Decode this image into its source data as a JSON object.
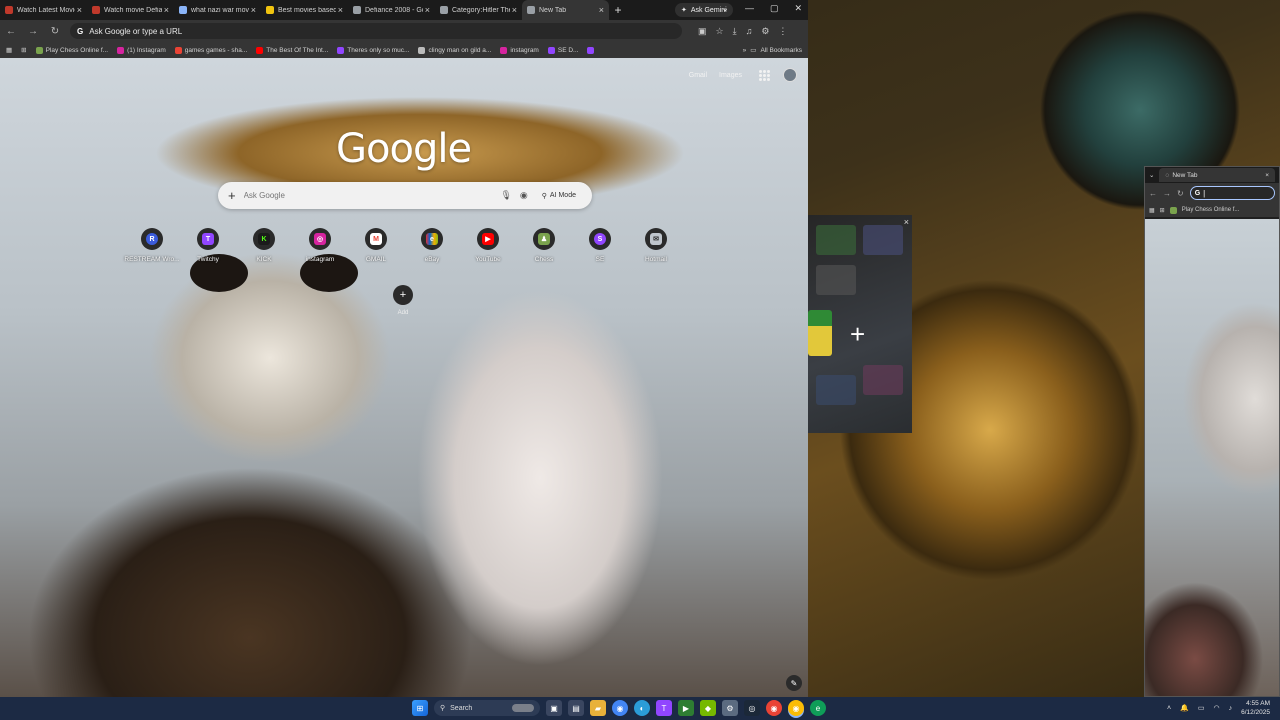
{
  "browser": {
    "tabs": [
      {
        "title": "Watch Latest Movies",
        "color": "#c0392b"
      },
      {
        "title": "Watch movie Defiance",
        "color": "#c0392b"
      },
      {
        "title": "what nazi war movie",
        "color": "#8ab4f8"
      },
      {
        "title": "Best movies based",
        "color": "#f1c40f"
      },
      {
        "title": "Defiance 2008 - Go",
        "color": "#9aa0a6"
      },
      {
        "title": "Category:Hitler The",
        "color": "#9aa0a6"
      },
      {
        "title": "New Tab",
        "color": "#9aa0a6"
      }
    ],
    "new_tab_symbol": "+",
    "gemini_label": "Ask Gemini",
    "omnibox_placeholder": "Ask Google or type a URL",
    "bookmarks": [
      {
        "label": "Play Chess Online f...",
        "color": "#7aa34d"
      },
      {
        "label": "(1) Instagram",
        "color": "#d6249f"
      },
      {
        "label": "games games - sha...",
        "color": "#ea4335"
      },
      {
        "label": "The Best Of The Int...",
        "color": "#ff0000"
      },
      {
        "label": "Theres only so muc...",
        "color": "#9146ff"
      },
      {
        "label": "clingy man on gild a...",
        "color": "#bbbbbb"
      },
      {
        "label": "instagram",
        "color": "#d6249f"
      },
      {
        "label": "SE D...",
        "color": "#9146ff"
      }
    ],
    "all_bookmarks": "All Bookmarks"
  },
  "newtab": {
    "top_links": [
      "Gmail",
      "Images"
    ],
    "logo": "Google",
    "search_placeholder": "Ask Google",
    "ai_mode": "AI Mode",
    "shortcuts": [
      {
        "label": "RESTREAM Wro...",
        "glyph": "R",
        "color": "#3b5bdb"
      },
      {
        "label": "Twitchy",
        "glyph": "T",
        "color": "#9146ff"
      },
      {
        "label": "KICK",
        "glyph": "K",
        "color": "#53fc18"
      },
      {
        "label": "instagram",
        "glyph": "◎",
        "color": "#d6249f"
      },
      {
        "label": "GMAIL",
        "glyph": "M",
        "color": "#ea4335"
      },
      {
        "label": "eBay",
        "glyph": "e",
        "color": "#e53238"
      },
      {
        "label": "YouTube",
        "glyph": "▶",
        "color": "#ff0000"
      },
      {
        "label": "Chess",
        "glyph": "♟",
        "color": "#7aa34d"
      },
      {
        "label": "SE",
        "glyph": "S",
        "color": "#9146ff"
      },
      {
        "label": "Hotmail",
        "glyph": "✉",
        "color": "#bfc5cc"
      }
    ],
    "add_shortcut_label": "Add"
  },
  "second_window": {
    "tab_title": "New Tab",
    "bookmark": "Play Chess Online f..."
  },
  "taskbar": {
    "search_label": "Search",
    "time": "4:55 AM",
    "date": "6/12/2025"
  }
}
